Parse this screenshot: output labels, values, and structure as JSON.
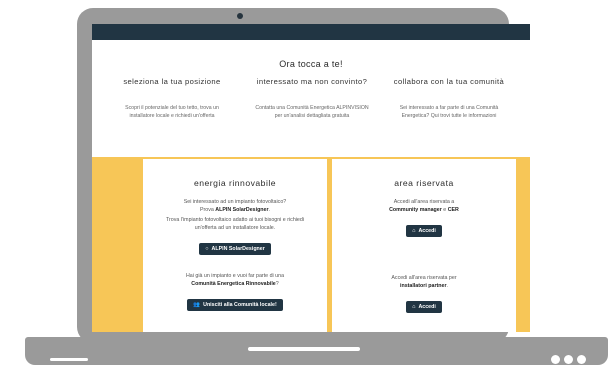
{
  "headline": "Ora tocca a te!",
  "columns": [
    {
      "title": "seleziona la tua posizione",
      "desc": "Scopri il potenziale del tuo tetto, trova un installatore locale e richiedi un'offerta"
    },
    {
      "title": "interessato ma non convinto?",
      "desc": "Contatta una Comunità Energetica ALPINVISION per un'analisi dettagliata gratuita"
    },
    {
      "title": "collabora con la tua comunità",
      "desc": "Sei interessato a far parte di una Comunità Energetica? Qui trovi tutte le informazioni"
    }
  ],
  "left_card": {
    "title": "energia rinnovabile",
    "line1": "Sei interessato ad un impianto fotovoltaico?",
    "line2_prefix": "Prova ",
    "line2_bold": "ALPIN SolarDesigner",
    "line2_suffix": ".",
    "line3": "Trova l'impianto fotovoltaico adatto ai tuoi bisogni e richiedi un'offerta ad un installatore locale.",
    "button1": "ALPIN SolarDesigner",
    "line4": "Hai già un impianto e vuoi far parte di una",
    "line5_bold": "Comunità Energetica Rinnovabile",
    "line5_suffix": "?",
    "button2": "Unisciti alla Comunità locale!"
  },
  "right_card": {
    "title": "area riservata",
    "line1": "Accedi all'area riservata a",
    "line2_bold1": "Community manager",
    "line2_mid": " e ",
    "line2_bold2": "CER",
    "button1": "Accedi",
    "line3": "Accedi all'area riservata per",
    "line4_bold": "installatori partner",
    "line4_suffix": ".",
    "button2": "Accedi"
  },
  "icons": {
    "solar_button": "circle-icon",
    "community_button": "users-icon",
    "login_button": "home-icon"
  },
  "colors": {
    "topbar": "#213543",
    "accent_yellow": "#f7c657",
    "button": "#213543",
    "frame": "#9a9a9a"
  }
}
